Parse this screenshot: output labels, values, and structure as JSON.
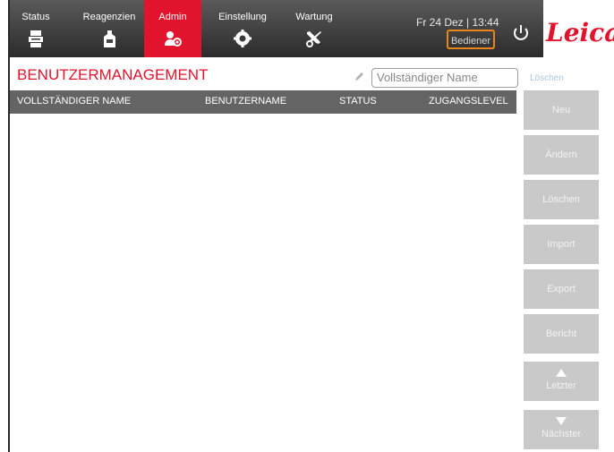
{
  "nav": {
    "items": [
      {
        "label": "Status",
        "icon": "printer-icon",
        "active": false
      },
      {
        "label": "Reagenzien",
        "icon": "reagent-bottle-icon",
        "active": false
      },
      {
        "label": "Admin",
        "icon": "admin-users-gear-icon",
        "active": true
      },
      {
        "label": "Einstellung",
        "icon": "settings-gear-icon",
        "active": false
      },
      {
        "label": "Wartung",
        "icon": "tools-icon",
        "active": false
      }
    ],
    "datetime": "Fr 24 Dez | 13:44",
    "user_level": "Bediener",
    "brand": "Leica",
    "colors": {
      "accent": "#e2142d",
      "highlight": "#e8861c",
      "bar": "#3a3a3a"
    }
  },
  "page": {
    "title": "BENUTZERMANAGEMENT",
    "search_placeholder": "Vollständiger Name",
    "clear_label": "Löschen"
  },
  "table": {
    "columns": [
      "VOLLSTÄNDIGER NAME",
      "BENUTZERNAME",
      "STATUS",
      "ZUGANGSLEVEL"
    ],
    "rows": []
  },
  "actions": {
    "new": "Neu",
    "edit": "Ändern",
    "delete": "Löschen",
    "import": "Import",
    "export": "Export",
    "report": "Bericht",
    "prev": "Letzter",
    "next": "Nächster"
  }
}
